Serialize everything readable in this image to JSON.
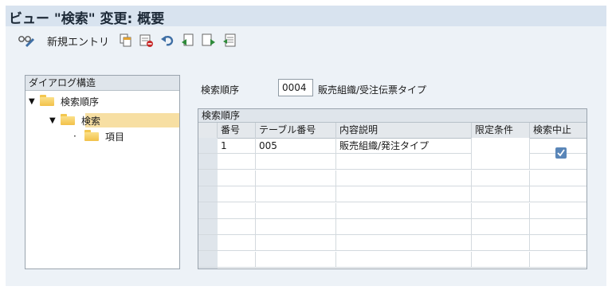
{
  "window": {
    "title": "ビュー \"検索\" 変更: 概要"
  },
  "toolbar": {
    "new_entries_label": "新規エントリ",
    "icons": [
      "glasses-edit-icon",
      "copy-icon",
      "delete-icon",
      "undo-icon",
      "doc-prev-icon",
      "doc-next-icon",
      "doc-table-icon"
    ]
  },
  "tree": {
    "header": "ダイアログ構造",
    "items": [
      {
        "label": "検索順序",
        "expanded": true
      },
      {
        "label": "検索",
        "expanded": true,
        "selected": true
      },
      {
        "label": "項目"
      }
    ]
  },
  "search_order": {
    "label": "検索順序",
    "value": "0004",
    "description": "販売組織/受注伝票タイプ"
  },
  "table": {
    "title": "検索順序",
    "columns": [
      "番号",
      "テーブル番号",
      "内容説明",
      "限定条件",
      "検索中止"
    ],
    "rows": [
      {
        "no": "1",
        "table_no": "005",
        "description": "販売組織/発注タイプ",
        "condition": "",
        "stop": true
      }
    ],
    "empty_rows": 7
  },
  "colors": {
    "title_bg": "#d8e3ef",
    "frame_bg": "#edf2f7",
    "selected_row": "#f7dfa3",
    "check": "#5a86b8"
  }
}
